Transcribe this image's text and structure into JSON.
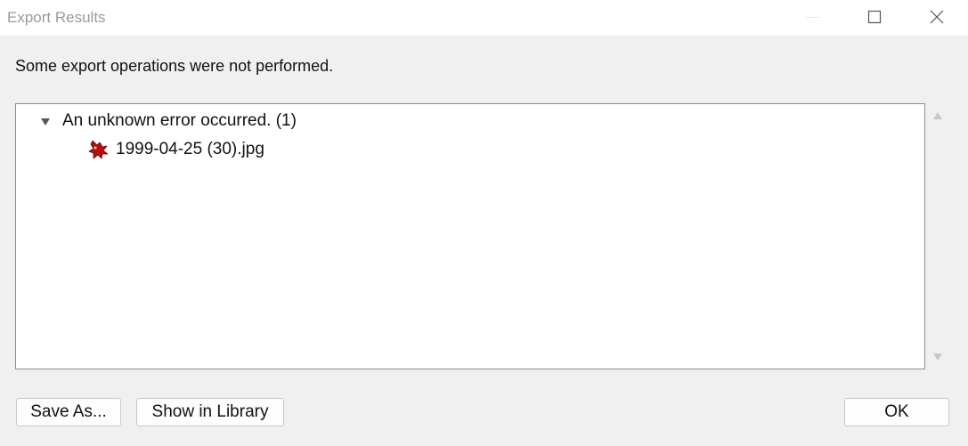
{
  "window": {
    "title": "Export Results"
  },
  "message": "Some export operations were not performed.",
  "tree": {
    "groups": [
      {
        "label": "An unknown error occurred. (1)",
        "expanded": true,
        "items": [
          {
            "label": "1999-04-25 (30).jpg",
            "icon": "error-icon"
          }
        ]
      }
    ]
  },
  "buttons": {
    "save_as": "Save As...",
    "show_in_library": "Show in Library",
    "ok": "OK"
  },
  "colors": {
    "dialog_background": "#f0f0f0",
    "error_icon": "#b01010",
    "title_text": "#9a9a9a"
  },
  "icons": {
    "minimize": "minimize-icon",
    "maximize": "maximize-icon",
    "close": "close-icon",
    "expander": "triangle-down-icon",
    "error": "error-icon",
    "scroll_up": "scroll-up-arrow-icon",
    "scroll_down": "scroll-down-arrow-icon"
  }
}
